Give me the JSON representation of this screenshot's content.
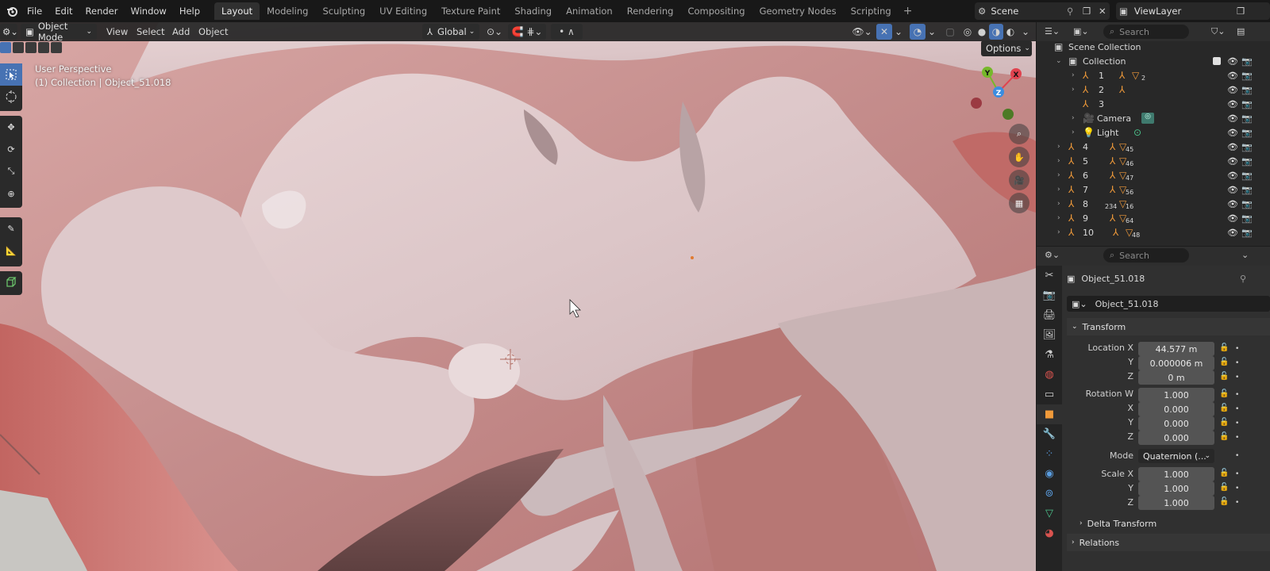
{
  "menu": {
    "items": [
      "File",
      "Edit",
      "Render",
      "Window",
      "Help"
    ]
  },
  "workspaces": {
    "tabs": [
      "Layout",
      "Modeling",
      "Sculpting",
      "UV Editing",
      "Texture Paint",
      "Shading",
      "Animation",
      "Rendering",
      "Compositing",
      "Geometry Nodes",
      "Scripting"
    ],
    "active": "Layout"
  },
  "scene": {
    "name": "Scene",
    "view_layer": "ViewLayer"
  },
  "viewport_header": {
    "mode": "Object Mode",
    "menus": [
      "View",
      "Select",
      "Add",
      "Object"
    ],
    "orientation": "Global",
    "options": "Options"
  },
  "viewport": {
    "perspective": "User Perspective",
    "collection_info": "(1) Collection | Object_51.018",
    "gizmo_axes": {
      "x": "X",
      "y": "Y",
      "z": "Z"
    }
  },
  "outliner": {
    "search_placeholder": "Search",
    "scene_collection": "Scene Collection",
    "collection": "Collection",
    "rows": [
      {
        "label": "1",
        "sub": "2"
      },
      {
        "label": "2",
        "sub": ""
      },
      {
        "label": "3",
        "sub": ""
      },
      {
        "label": "Camera",
        "sub": ""
      },
      {
        "label": "Light",
        "sub": ""
      },
      {
        "label": "4",
        "sub": "45"
      },
      {
        "label": "5",
        "sub": "46"
      },
      {
        "label": "6",
        "sub": "47"
      },
      {
        "label": "7",
        "sub": "56"
      },
      {
        "label": "8",
        "sub": "16",
        "pre": "234"
      },
      {
        "label": "9",
        "sub": "64"
      },
      {
        "label": "10",
        "sub": "48"
      }
    ]
  },
  "properties": {
    "search_placeholder": "Search",
    "object_name": "Object_51.018",
    "object_field": "Object_51.018",
    "transform_label": "Transform",
    "location": {
      "label": "Location X",
      "x": "44.577 m",
      "y": "0.000006 m",
      "z": "0 m"
    },
    "rotation": {
      "label": "Rotation W",
      "w": "1.000",
      "x": "0.000",
      "y": "0.000",
      "z": "0.000"
    },
    "mode": {
      "label": "Mode",
      "value": "Quaternion (..."
    },
    "scale": {
      "label": "Scale X",
      "x": "1.000",
      "y": "1.000",
      "z": "1.000"
    },
    "axis_labels": {
      "x": "X",
      "y": "Y",
      "z": "Z"
    },
    "delta_transform": "Delta Transform",
    "relations": "Relations"
  },
  "colors": {
    "accent": "#4772b3",
    "object_orange": "#f09a3a",
    "axis_x": "#e0434f",
    "axis_y": "#76b82a",
    "axis_z": "#3b8de0"
  }
}
